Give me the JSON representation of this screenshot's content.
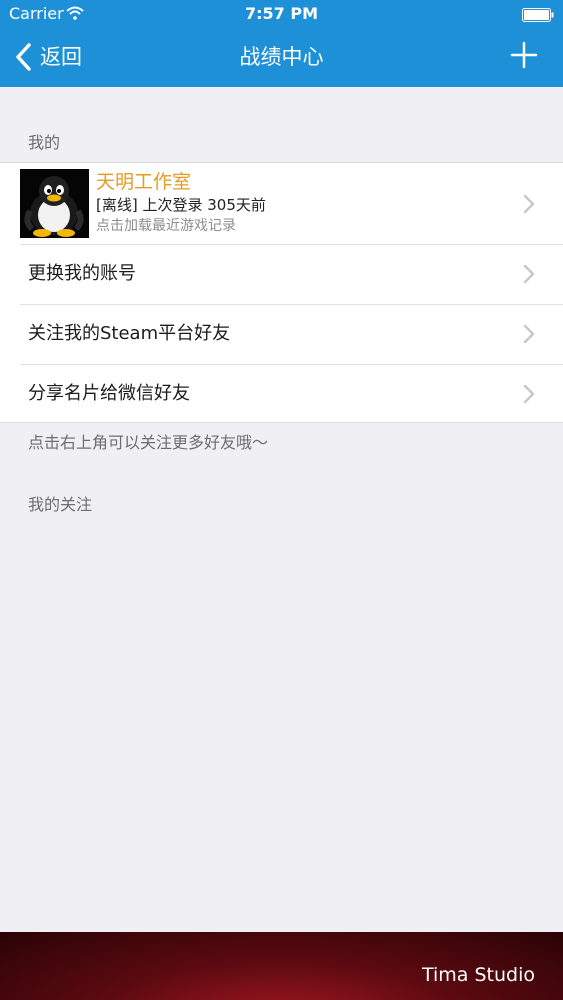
{
  "status_bar": {
    "carrier": "Carrier",
    "time": "7:57 PM"
  },
  "nav": {
    "back_label": "返回",
    "title": "战绩中心"
  },
  "sections": {
    "mine_header": "我的",
    "footnote": "点击右上角可以关注更多好友哦～",
    "follow_header": "我的关注"
  },
  "profile": {
    "name": "天明工作室",
    "status": "[离线] 上次登录 305天前",
    "hint": "点击加载最近游戏记录"
  },
  "menu": {
    "items": [
      {
        "label": "更换我的账号"
      },
      {
        "label": "关注我的Steam平台好友"
      },
      {
        "label": "分享名片给微信好友"
      }
    ]
  },
  "footer": {
    "brand": "Tima Studio"
  },
  "colors": {
    "nav_bar": "#1d90d8",
    "background": "#efeff4",
    "profile_name": "#e69b27",
    "footer": "#5c0a10"
  },
  "icons": {
    "back": "chevron-left-icon",
    "add": "plus-icon",
    "wifi": "wifi-icon",
    "battery": "battery-icon",
    "row_disclosure": "chevron-right-icon",
    "avatar": "penguin-avatar"
  }
}
